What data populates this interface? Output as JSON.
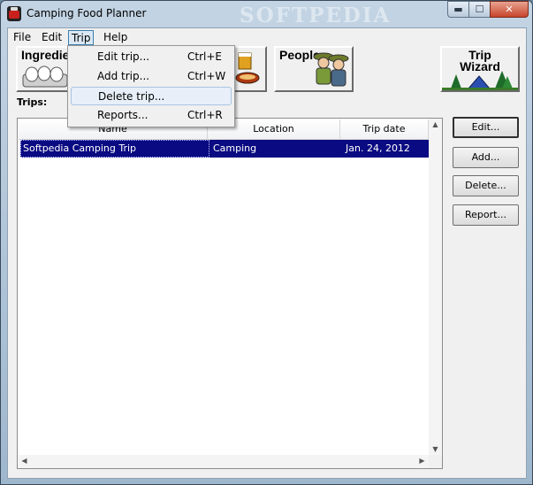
{
  "window": {
    "title": "Camping Food Planner",
    "watermark": "SOFTPEDIA",
    "controls": {
      "minimize": "▬",
      "maximize": "☐",
      "close": "✕"
    }
  },
  "menubar": [
    "File",
    "Edit",
    "Trip",
    "Help"
  ],
  "trip_menu": [
    {
      "label": "Edit trip...",
      "shortcut": "Ctrl+E"
    },
    {
      "label": "Add trip...",
      "shortcut": "Ctrl+W"
    },
    {
      "label": "Delete trip...",
      "shortcut": ""
    },
    {
      "label": "Reports...",
      "shortcut": "Ctrl+R"
    }
  ],
  "toolbar": {
    "ingredients": "Ingredie",
    "people": "People",
    "wizard_line1": "Trip",
    "wizard_line2": "Wizard"
  },
  "trips": {
    "label": "Trips:",
    "columns": [
      "Name",
      "Location",
      "Trip date"
    ],
    "rows": [
      {
        "name": "Softpedia Camping Trip",
        "location": "Camping",
        "date": "Jan. 24, 2012"
      }
    ]
  },
  "buttons": {
    "edit": "Edit...",
    "add": "Add...",
    "delete": "Delete...",
    "report": "Report..."
  },
  "colors": {
    "selection": "#0a0a82",
    "menu_highlight": "#e8eff8",
    "window_frame": "#b4c8da"
  }
}
